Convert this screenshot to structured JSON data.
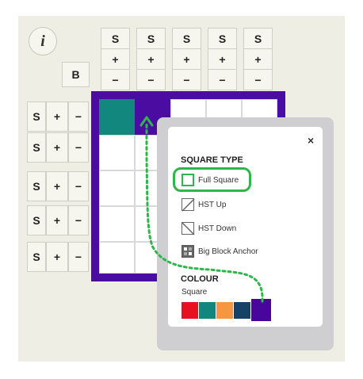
{
  "info_label": "i",
  "b_label": "B",
  "col_buttons": {
    "s": "S",
    "plus": "+",
    "minus": "−"
  },
  "row_buttons": {
    "s": "S",
    "plus": "+",
    "minus": "−"
  },
  "panel": {
    "close": "×",
    "square_type_heading": "SQUARE TYPE",
    "options": [
      "Full Square",
      "HST Up",
      "HST Down",
      "Big Block Anchor"
    ],
    "colour_heading": "COLOUR",
    "colour_sub": "Square"
  },
  "colors": {
    "swatches": [
      "#e8111f",
      "#11867d",
      "#f59640",
      "#174268",
      "#48069d"
    ],
    "grid_border": "#4b0da1",
    "teal_cell": "#11877d",
    "highlight": "#2fb64a"
  },
  "icons": [
    "info-icon",
    "close-icon",
    "full-square-icon",
    "hst-up-icon",
    "hst-down-icon",
    "big-block-anchor-icon"
  ]
}
